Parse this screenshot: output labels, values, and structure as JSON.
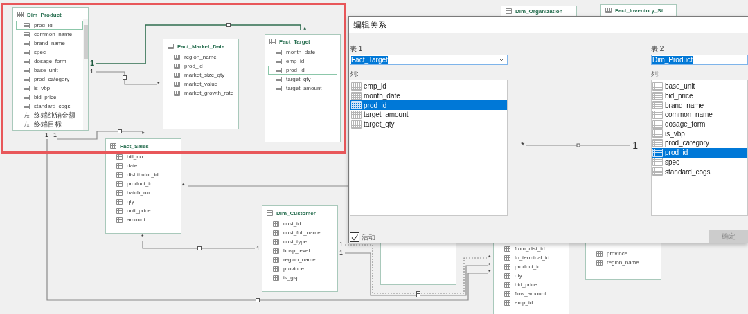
{
  "diagram": {
    "tables": [
      {
        "title": "Dim_Product",
        "scrollable": true,
        "fields": [
          {
            "name": "prod_id",
            "kind": "column",
            "selected": true
          },
          {
            "name": "common_name",
            "kind": "column",
            "selected": false
          },
          {
            "name": "brand_name",
            "kind": "column",
            "selected": false
          },
          {
            "name": "spec",
            "kind": "column",
            "selected": false
          },
          {
            "name": "dosage_form",
            "kind": "column",
            "selected": false
          },
          {
            "name": "base_unit",
            "kind": "column",
            "selected": false
          },
          {
            "name": "prod_category",
            "kind": "column",
            "selected": false
          },
          {
            "name": "is_vbp",
            "kind": "column",
            "selected": false
          },
          {
            "name": "bid_price",
            "kind": "column",
            "selected": false
          },
          {
            "name": "standard_cogs",
            "kind": "column",
            "selected": false
          },
          {
            "name": "终端纯销金额",
            "kind": "measure",
            "selected": false
          },
          {
            "name": "终端目标",
            "kind": "measure",
            "selected": false
          }
        ]
      },
      {
        "title": "Fact_Market_Data",
        "scrollable": false,
        "fields": [
          {
            "name": "region_name",
            "kind": "column",
            "selected": false
          },
          {
            "name": "prod_id",
            "kind": "column",
            "selected": false
          },
          {
            "name": "market_size_qty",
            "kind": "column",
            "selected": false
          },
          {
            "name": "market_value",
            "kind": "column",
            "selected": false
          },
          {
            "name": "market_growth_rate",
            "kind": "column",
            "selected": false
          }
        ]
      },
      {
        "title": "Fact_Target",
        "scrollable": false,
        "fields": [
          {
            "name": "month_date",
            "kind": "column",
            "selected": false
          },
          {
            "name": "emp_id",
            "kind": "column",
            "selected": false
          },
          {
            "name": "prod_id",
            "kind": "column",
            "selected": true
          },
          {
            "name": "target_qty",
            "kind": "column",
            "selected": false
          },
          {
            "name": "target_amount",
            "kind": "column",
            "selected": false
          }
        ]
      },
      {
        "title": "Fact_Sales",
        "scrollable": false,
        "fields": [
          {
            "name": "bill_no",
            "kind": "column",
            "selected": false
          },
          {
            "name": "date",
            "kind": "column",
            "selected": false
          },
          {
            "name": "distributor_id",
            "kind": "column",
            "selected": false
          },
          {
            "name": "product_id",
            "kind": "column",
            "selected": false
          },
          {
            "name": "batch_no",
            "kind": "column",
            "selected": false
          },
          {
            "name": "qty",
            "kind": "column",
            "selected": false
          },
          {
            "name": "unit_price",
            "kind": "column",
            "selected": false
          },
          {
            "name": "amount",
            "kind": "column",
            "selected": false
          }
        ]
      },
      {
        "title": "Dim_Customer",
        "scrollable": false,
        "fields": [
          {
            "name": "cust_id",
            "kind": "column",
            "selected": false
          },
          {
            "name": "cust_full_name",
            "kind": "column",
            "selected": false
          },
          {
            "name": "cust_type",
            "kind": "column",
            "selected": false
          },
          {
            "name": "hosp_level",
            "kind": "column",
            "selected": false
          },
          {
            "name": "region_name",
            "kind": "column",
            "selected": false
          },
          {
            "name": "province",
            "kind": "column",
            "selected": false
          },
          {
            "name": "is_gsp",
            "kind": "column",
            "selected": false
          }
        ]
      },
      {
        "scrollable": false,
        "fields": [
          {
            "name": "from_dist_id",
            "kind": "column",
            "selected": false
          },
          {
            "name": "to_terminal_id",
            "kind": "column",
            "selected": false
          },
          {
            "name": "product_id",
            "kind": "column",
            "selected": false
          },
          {
            "name": "qty",
            "kind": "column",
            "selected": false
          },
          {
            "name": "bid_price",
            "kind": "column",
            "selected": false
          },
          {
            "name": "flow_amount",
            "kind": "column",
            "selected": false
          },
          {
            "name": "emp_id",
            "kind": "column",
            "selected": false
          }
        ]
      },
      {
        "scrollable": false,
        "fields": [
          {
            "name": "province",
            "kind": "column",
            "selected": false
          },
          {
            "name": "region_name",
            "kind": "column",
            "selected": false
          }
        ]
      },
      {
        "title": "Dim_Organization"
      },
      {
        "title": "Fact_Inventory_St..."
      }
    ],
    "relationships": [
      {
        "one_end": "1",
        "many_end": "*",
        "active": true,
        "selected": true
      },
      {
        "one_end": "1",
        "many_end": "*",
        "active": true,
        "selected": false
      },
      {
        "one_end": "1",
        "many_end": "*",
        "active": true,
        "selected": false
      },
      {
        "one_end": "1",
        "many_end": "*",
        "active": true,
        "selected": false
      },
      {
        "many_end": "*",
        "active": true,
        "selected": false
      },
      {
        "one_end": "1",
        "many_end": "*",
        "active": true,
        "selected": false
      },
      {
        "one_end": "1",
        "many_end": "*",
        "active": false,
        "selected": false
      },
      {
        "one_end": "1",
        "many_end": "*",
        "active": true,
        "selected": false
      }
    ]
  },
  "dialog": {
    "title": "编辑关系",
    "table_1": {
      "label": "表 1",
      "value": "Fact_Target",
      "columns_label": "列:",
      "columns": [
        {
          "name": "emp_id",
          "selected": false
        },
        {
          "name": "month_date",
          "selected": false
        },
        {
          "name": "prod_id",
          "selected": true
        },
        {
          "name": "target_amount",
          "selected": false
        },
        {
          "name": "target_qty",
          "selected": false
        }
      ]
    },
    "cardinality": {
      "many_end": "*",
      "one_end": "1"
    },
    "table_2": {
      "label": "表 2",
      "value": "Dim_Product",
      "columns_label": "列:",
      "columns": [
        {
          "name": "base_unit",
          "selected": false
        },
        {
          "name": "bid_price",
          "selected": false
        },
        {
          "name": "brand_name",
          "selected": false
        },
        {
          "name": "common_name",
          "selected": false
        },
        {
          "name": "dosage_form",
          "selected": false
        },
        {
          "name": "is_vbp",
          "selected": false
        },
        {
          "name": "prod_category",
          "selected": false
        },
        {
          "name": "prod_id",
          "selected": true
        },
        {
          "name": "spec",
          "selected": false
        },
        {
          "name": "standard_cogs",
          "selected": false
        }
      ]
    },
    "active_checkbox": {
      "label": "活动",
      "checked": true
    },
    "ok_button": {
      "label": "确定",
      "disabled": true
    }
  }
}
